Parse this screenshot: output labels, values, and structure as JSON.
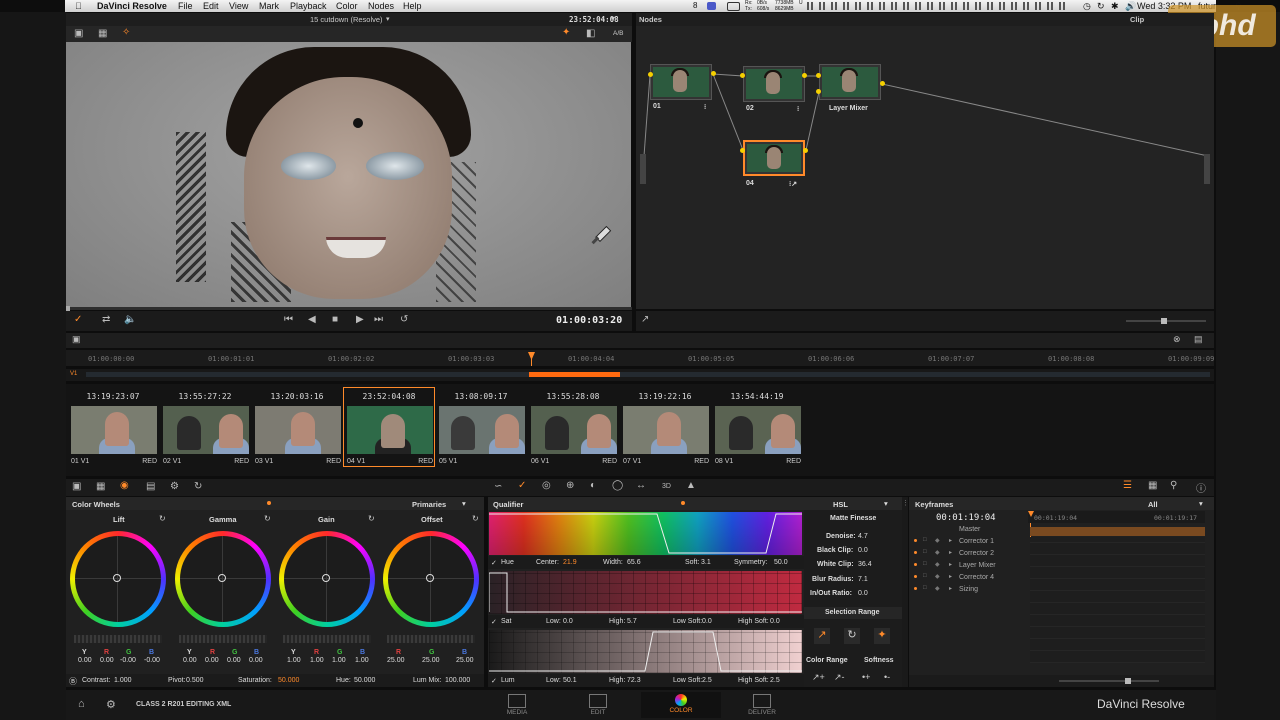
{
  "menubar": {
    "app": "DaVinci Resolve",
    "items": [
      "File",
      "Edit",
      "View",
      "Mark",
      "Playback",
      "Color",
      "Nodes",
      "Help"
    ],
    "status_time": "Wed 3:32 PM",
    "user": "future",
    "status_badge": "8",
    "net_rx": "Rx:",
    "net_tx": "Tx:",
    "net_up": "0B/s",
    "net_down": "608/s",
    "mem_a": "7738MB",
    "mem_b": "8629MB",
    "mem_label_u": "U"
  },
  "watermark": {
    "text": "fxphd"
  },
  "viewer": {
    "title": "15 cutdown (Resolve)",
    "source_tc": "23:52:04:08",
    "ab_label": "A/B",
    "timecode": "01:00:03:20"
  },
  "nodes": {
    "header": "Nodes",
    "clip_label": "Clip",
    "node_01": "01",
    "node_02": "02",
    "node_04": "04",
    "mixer": "Layer Mixer"
  },
  "timeline": {
    "ruler": [
      "01:00:00:00",
      "01:00:01:01",
      "01:00:02:02",
      "01:00:03:03",
      "01:00:04:04",
      "01:00:05:05",
      "01:00:06:06",
      "01:00:07:07",
      "01:00:08:08",
      "01:00:09:09"
    ],
    "track_label": "V1",
    "playhead_pct": 0.405
  },
  "clips": [
    {
      "tc": "13:19:23:07",
      "num": "01",
      "track": "V1",
      "tag": "RED"
    },
    {
      "tc": "13:55:27:22",
      "num": "02",
      "track": "V1",
      "tag": "RED"
    },
    {
      "tc": "13:20:03:16",
      "num": "03",
      "track": "V1",
      "tag": "RED"
    },
    {
      "tc": "23:52:04:08",
      "num": "04",
      "track": "V1",
      "tag": "RED"
    },
    {
      "tc": "13:08:09:17",
      "num": "05",
      "track": "V1",
      "tag": ""
    },
    {
      "tc": "13:55:28:08",
      "num": "06",
      "track": "V1",
      "tag": "RED"
    },
    {
      "tc": "13:19:22:16",
      "num": "07",
      "track": "V1",
      "tag": "RED"
    },
    {
      "tc": "13:54:44:19",
      "num": "08",
      "track": "V1",
      "tag": "RED"
    }
  ],
  "color_wheels": {
    "title": "Color Wheels",
    "mode": "Primaries",
    "wheels": [
      {
        "name": "Lift",
        "y": "0.00",
        "r": "0.00",
        "g": "-0.00",
        "b": "-0.00"
      },
      {
        "name": "Gamma",
        "y": "0.00",
        "r": "0.00",
        "g": "0.00",
        "b": "0.00"
      },
      {
        "name": "Gain",
        "y": "1.00",
        "r": "1.00",
        "g": "1.00",
        "b": "1.00"
      },
      {
        "name": "Offset",
        "y": "",
        "r": "25.00",
        "g": "25.00",
        "b": "25.00"
      }
    ],
    "chan_y": "Y",
    "chan_r": "R",
    "chan_g": "G",
    "chan_b": "B",
    "contrast_label": "Contrast:",
    "contrast": "1.000",
    "pivot_label": "Pivot:",
    "pivot": "0.500",
    "saturation_label": "Saturation:",
    "saturation": "50.000",
    "hue_label": "Hue:",
    "hue": "50.000",
    "lummix_label": "Lum Mix:",
    "lummix": "100.000"
  },
  "qualifier": {
    "title": "Qualifier",
    "mode": "HSL",
    "hue": {
      "label": "Hue",
      "center_label": "Center:",
      "center": "21.9",
      "width_label": "Width:",
      "width": "65.6",
      "soft_label": "Soft:",
      "soft": "3.1",
      "sym_label": "Symmetry:",
      "sym": "50.0"
    },
    "sat": {
      "label": "Sat",
      "low_label": "Low:",
      "low": "0.0",
      "high_label": "High:",
      "high": "5.7",
      "lsoft_label": "Low Soft:",
      "lsoft": "0.0",
      "hsoft_label": "High Soft:",
      "hsoft": "0.0"
    },
    "lum": {
      "label": "Lum",
      "low_label": "Low:",
      "low": "50.1",
      "high_label": "High:",
      "high": "72.3",
      "lsoft_label": "Low Soft:",
      "lsoft": "2.5",
      "hsoft_label": "High Soft:",
      "hsoft": "2.5"
    }
  },
  "matte": {
    "title": "Matte Finesse",
    "denoise_label": "Denoise:",
    "denoise": "4.7",
    "black_label": "Black Clip:",
    "black": "0.0",
    "white_label": "White Clip:",
    "white": "36.4",
    "blur_label": "Blur Radius:",
    "blur": "7.1",
    "inout_label": "In/Out Ratio:",
    "inout": "0.0",
    "selection_range": "Selection Range",
    "color_range": "Color Range",
    "softness": "Softness"
  },
  "keyframes": {
    "title": "Keyframes",
    "filter": "All",
    "timecode": "00:01:19:04",
    "ruler_a": "00:01:19:04",
    "ruler_b": "00:01:19:17",
    "tracks": [
      "Master",
      "Corrector 1",
      "Corrector 2",
      "Layer Mixer",
      "Corrector 4",
      "Sizing"
    ]
  },
  "dock": {
    "project": "CLASS 2 R201 EDITING XML",
    "pages": [
      "MEDIA",
      "EDIT",
      "COLOR",
      "DELIVER"
    ],
    "brand": "DaVinci Resolve"
  },
  "colors": {
    "accent": "#ff8a2a",
    "node_dot": "#f5d000",
    "active_page": "#ff8a2a"
  }
}
